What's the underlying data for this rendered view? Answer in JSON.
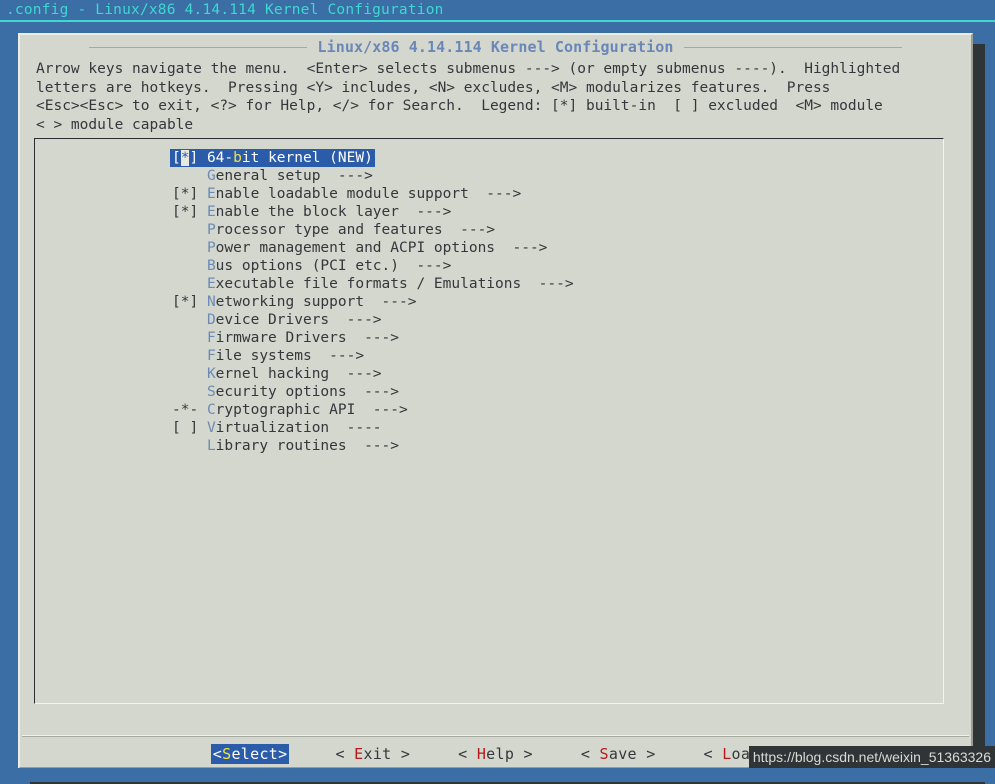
{
  "terminal": {
    "title": ".config - Linux/x86 4.14.114 Kernel Configuration"
  },
  "dialog": {
    "title": "Linux/x86 4.14.114 Kernel Configuration",
    "help_text": "Arrow keys navigate the menu.  <Enter> selects submenus ---> (or empty submenus ----).  Highlighted\nletters are hotkeys.  Pressing <Y> includes, <N> excludes, <M> modularizes features.  Press\n<Esc><Esc> to exit, <?> for Help, </> for Search.  Legend: [*] built-in  [ ] excluded  <M> module\n< > module capable"
  },
  "menu": {
    "items": [
      {
        "marker": "[*]",
        "hotkey": "b",
        "pre": "64-",
        "post": "it kernel (NEW)",
        "arrow": "",
        "selected": true
      },
      {
        "marker": "   ",
        "hotkey": "G",
        "pre": "",
        "post": "eneral setup",
        "arrow": "  --->",
        "selected": false
      },
      {
        "marker": "[*]",
        "hotkey": "E",
        "pre": "",
        "post": "nable loadable module support",
        "arrow": "  --->",
        "selected": false
      },
      {
        "marker": "[*]",
        "hotkey": "E",
        "pre": "",
        "post": "nable the block layer",
        "arrow": "  --->",
        "selected": false
      },
      {
        "marker": "   ",
        "hotkey": "P",
        "pre": "",
        "post": "rocessor type and features",
        "arrow": "  --->",
        "selected": false
      },
      {
        "marker": "   ",
        "hotkey": "P",
        "pre": "",
        "post": "ower management and ACPI options",
        "arrow": "  --->",
        "selected": false
      },
      {
        "marker": "   ",
        "hotkey": "B",
        "pre": "",
        "post": "us options (PCI etc.)",
        "arrow": "  --->",
        "selected": false
      },
      {
        "marker": "   ",
        "hotkey": "E",
        "pre": "",
        "post": "xecutable file formats / Emulations",
        "arrow": "  --->",
        "selected": false
      },
      {
        "marker": "[*]",
        "hotkey": "N",
        "pre": "",
        "post": "etworking support",
        "arrow": "  --->",
        "selected": false
      },
      {
        "marker": "   ",
        "hotkey": "D",
        "pre": "",
        "post": "evice Drivers",
        "arrow": "  --->",
        "selected": false
      },
      {
        "marker": "   ",
        "hotkey": "F",
        "pre": "",
        "post": "irmware Drivers",
        "arrow": "  --->",
        "selected": false
      },
      {
        "marker": "   ",
        "hotkey": "F",
        "pre": "",
        "post": "ile systems",
        "arrow": "  --->",
        "selected": false
      },
      {
        "marker": "   ",
        "hotkey": "K",
        "pre": "",
        "post": "ernel hacking",
        "arrow": "  --->",
        "selected": false
      },
      {
        "marker": "   ",
        "hotkey": "S",
        "pre": "",
        "post": "ecurity options",
        "arrow": "  --->",
        "selected": false
      },
      {
        "marker": "-*-",
        "hotkey": "C",
        "pre": "",
        "post": "ryptographic API",
        "arrow": "  --->",
        "selected": false
      },
      {
        "marker": "[ ]",
        "hotkey": "V",
        "pre": "",
        "post": "irtualization",
        "arrow": "  ----",
        "selected": false
      },
      {
        "marker": "   ",
        "hotkey": "L",
        "pre": "",
        "post": "ibrary routines",
        "arrow": "  --->",
        "selected": false
      }
    ]
  },
  "buttons": [
    {
      "left": "<",
      "hotkey": "S",
      "rest": "elect",
      "right": ">",
      "active": true
    },
    {
      "left": "< ",
      "hotkey": "E",
      "rest": "xit",
      "right": " >",
      "active": false
    },
    {
      "left": "< ",
      "hotkey": "H",
      "rest": "elp",
      "right": " >",
      "active": false
    },
    {
      "left": "< ",
      "hotkey": "S",
      "rest": "ave",
      "right": " >",
      "active": false
    },
    {
      "left": "< ",
      "hotkey": "L",
      "rest": "oad",
      "right": " >",
      "active": false
    }
  ],
  "watermark": {
    "text": "https://blog.csdn.net/weixin_51363326"
  },
  "colors": {
    "backdrop": "#3a6ea5",
    "terminal_title_text": "#3fd8d0",
    "dialog_bg": "#d4d7cd",
    "dialog_title": "#6a87b8",
    "hotkey_menu": "#6a8ab5",
    "hotkey_button": "#b9181a",
    "selection_bg": "#2a5caa",
    "selection_hotkey": "#f5e03c",
    "shadow": "#2f3437"
  }
}
